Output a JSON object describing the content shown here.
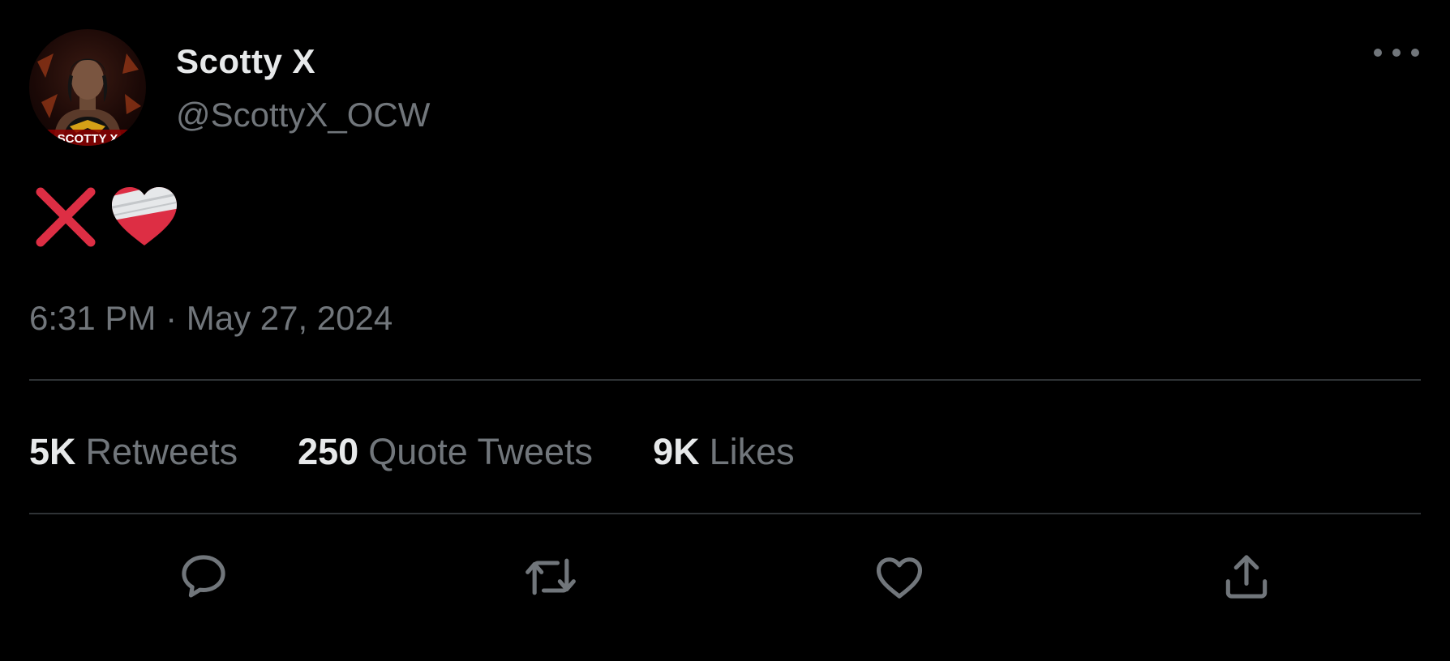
{
  "author": {
    "name": "Scotty X",
    "handle": "@ScottyX_OCW",
    "avatar_text": "SCOTTY X"
  },
  "tweet": {
    "emojis": [
      "cross-mark-emoji",
      "mending-heart-emoji"
    ],
    "timestamp": "6:31 PM · May 27, 2024"
  },
  "stats": [
    {
      "count": "5K",
      "label": "Retweets"
    },
    {
      "count": "250",
      "label": "Quote Tweets"
    },
    {
      "count": "9K",
      "label": "Likes"
    }
  ],
  "actions": [
    "reply-icon",
    "retweet-icon",
    "like-icon",
    "share-icon"
  ],
  "colors": {
    "background": "#000000",
    "primary_text": "#e7e9ea",
    "secondary_text": "#71767b",
    "divider": "#2f3336",
    "cross_red": "#dd2e44"
  }
}
